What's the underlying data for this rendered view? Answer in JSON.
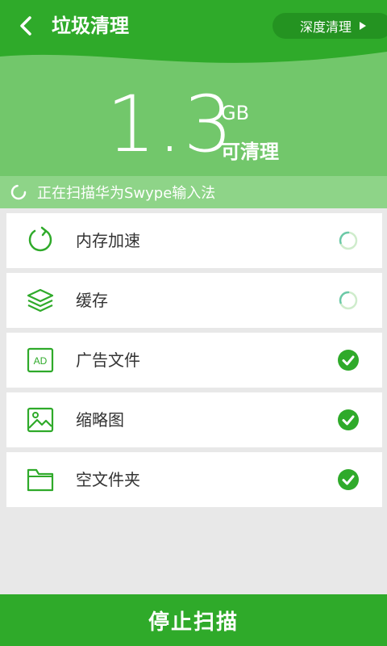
{
  "header": {
    "title": "垃圾清理",
    "deep_clean_label": "深度清理",
    "size_value": "1.3",
    "size_unit": "GB",
    "size_caption": "可清理",
    "scan_status": "正在扫描华为Swype输入法"
  },
  "colors": {
    "brand_green": "#2faa2a",
    "header_green": "#72c76b",
    "status_green": "#8ed488",
    "done_green": "#2faa2a"
  },
  "items": [
    {
      "label": "内存加速",
      "icon": "memory-boost-icon",
      "state": "scanning"
    },
    {
      "label": "缓存",
      "icon": "cache-layers-icon",
      "state": "scanning"
    },
    {
      "label": "广告文件",
      "icon": "ad-file-icon",
      "state": "done"
    },
    {
      "label": "缩略图",
      "icon": "thumbnail-image-icon",
      "state": "done"
    },
    {
      "label": "空文件夹",
      "icon": "empty-folder-icon",
      "state": "done"
    }
  ],
  "footer": {
    "stop_label": "停止扫描"
  }
}
